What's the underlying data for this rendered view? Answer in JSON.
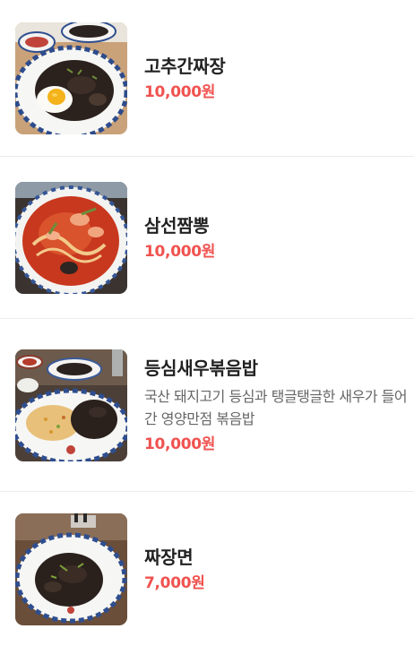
{
  "menu": {
    "items": [
      {
        "name": "고추간짜장",
        "price": "10,000원",
        "image_icon": "jjajang-fried-egg-photo"
      },
      {
        "name": "삼선짬뽕",
        "price": "10,000원",
        "image_icon": "seafood-jjamppong-photo"
      },
      {
        "name": "등심새우볶음밥",
        "description": "국산 돼지고기 등심과 탱글탱글한 새우가 들어간 영양만점 볶음밥",
        "price": "10,000원",
        "image_icon": "fried-rice-photo"
      },
      {
        "name": "짜장면",
        "price": "7,000원",
        "image_icon": "jjajangmyeon-photo"
      }
    ]
  },
  "colors": {
    "price": "#f0524f",
    "title": "#222222",
    "description": "#666666",
    "divider": "#ececec"
  }
}
